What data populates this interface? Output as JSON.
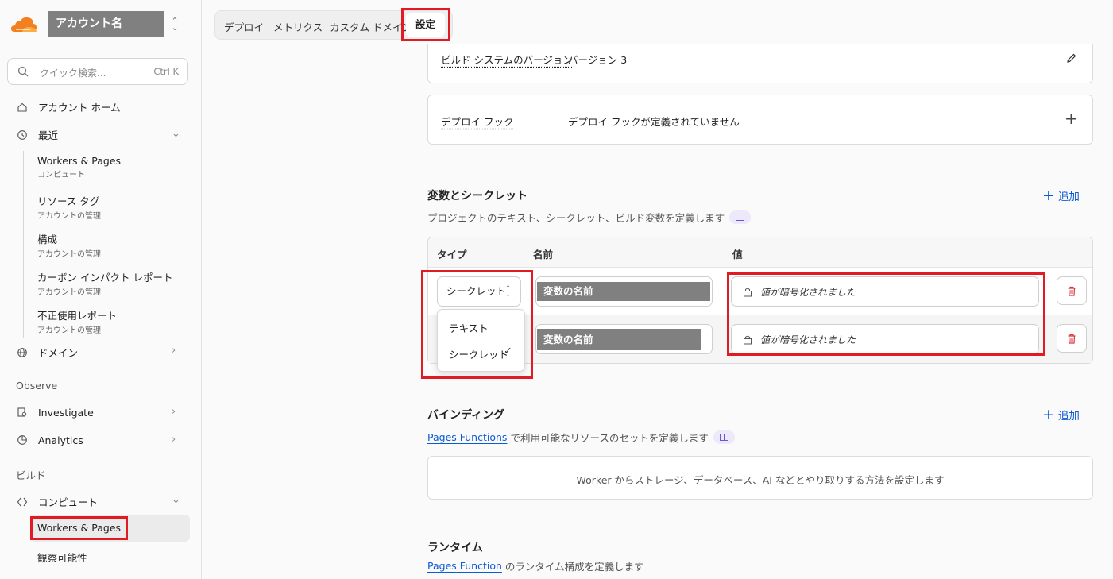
{
  "account": {
    "name": "アカウント名"
  },
  "search": {
    "placeholder": "クイック検索...",
    "shortcut": "Ctrl K"
  },
  "sidebar": {
    "home": "アカウント ホーム",
    "recent": "最近",
    "recent_items": [
      {
        "title": "Workers & Pages",
        "subtitle": "コンピュート"
      },
      {
        "title": "リソース タグ",
        "subtitle": "アカウントの管理"
      },
      {
        "title": "構成",
        "subtitle": "アカウントの管理"
      },
      {
        "title": "カーボン インパクト レポート",
        "subtitle": "アカウントの管理"
      },
      {
        "title": "不正使用レポート",
        "subtitle": "アカウントの管理"
      }
    ],
    "domain": "ドメイン",
    "observe_group": "Observe",
    "investigate": "Investigate",
    "analytics": "Analytics",
    "build_group": "ビルド",
    "compute": "コンピュート",
    "workers_pages": "Workers & Pages",
    "observability": "観察可能性"
  },
  "tabs": [
    "デプロイ",
    "メトリクス",
    "カスタム ドメイン",
    "設定"
  ],
  "active_tab": "設定",
  "build_system": {
    "label": "ビルド システムのバージョン",
    "value": "バージョン 3"
  },
  "deploy_hooks": {
    "label": "デプロイ フック",
    "value": "デプロイ フックが定義されていません"
  },
  "variables": {
    "title": "変数とシークレット",
    "description": "プロジェクトのテキスト、シークレット、ビルド変数を定義します",
    "add_label": "追加",
    "columns": [
      "タイプ",
      "名前",
      "値"
    ],
    "rows": [
      {
        "type": "シークレット",
        "name": "変数の名前",
        "value": "値が暗号化されました"
      },
      {
        "type": "シークレット",
        "name": "変数の名前",
        "value": "値が暗号化されました"
      }
    ],
    "type_options": [
      "テキスト",
      "シークレット"
    ],
    "selected_option": "シークレット"
  },
  "bindings": {
    "title": "バインディング",
    "link": "Pages Functions",
    "description": "で利用可能なリソースのセットを定義します",
    "add_label": "追加",
    "empty": "Worker からストレージ、データベース、AI などとやり取りする方法を設定します"
  },
  "runtime": {
    "title": "ランタイム",
    "link": "Pages Function",
    "description": "のランタイム構成を定義します"
  },
  "colors": {
    "accent": "#0b5bd3",
    "highlight": "#e01b24",
    "cloud_orange": "#f38020",
    "delete_red": "#d9363e"
  }
}
